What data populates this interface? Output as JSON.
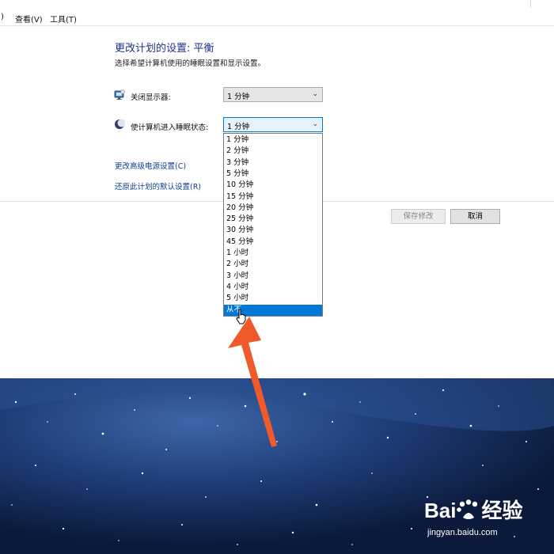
{
  "menu": {
    "partial_item": ")",
    "view": "查看(V)",
    "tools": "工具(T)"
  },
  "page": {
    "title": "更改计划的设置: 平衡",
    "subtitle": "选择希望计算机使用的睡眠设置和显示设置。"
  },
  "display_off": {
    "label": "关闭显示器:",
    "value": "1 分钟",
    "icon": "monitor-icon"
  },
  "sleep": {
    "label": "使计算机进入睡眠状态:",
    "value": "1 分钟",
    "icon": "moon-icon"
  },
  "links": {
    "advanced": "更改高级电源设置(C)",
    "restore": "还原此计划的默认设置(R)"
  },
  "buttons": {
    "save": "保存修改",
    "cancel": "取消"
  },
  "dropdown": {
    "options": [
      "1 分钟",
      "2 分钟",
      "3 分钟",
      "5 分钟",
      "10 分钟",
      "15 分钟",
      "20 分钟",
      "25 分钟",
      "30 分钟",
      "45 分钟",
      "1 小时",
      "2 小时",
      "3 小时",
      "4 小时",
      "5 小时",
      "从不"
    ],
    "selected": "从不"
  },
  "watermark": {
    "brand": "Bai",
    "brand_cn": "经验",
    "url": "jingyan.baidu.com"
  },
  "colors": {
    "accent": "#0078d7",
    "link": "#0d3d95",
    "title": "#1e3287",
    "arrow": "#f0592a",
    "desktop": "#13274d"
  }
}
